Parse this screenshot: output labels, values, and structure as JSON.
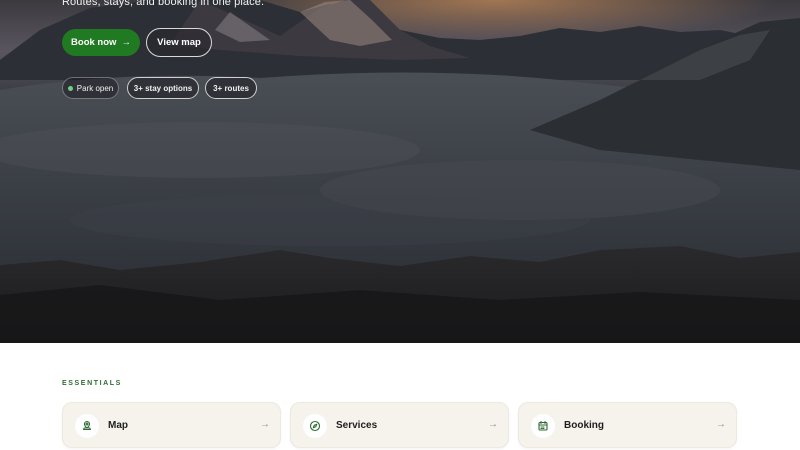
{
  "hero": {
    "tagline": "Routes, stays, and booking in one place.",
    "book_label": "Book now",
    "book_arrow": "→",
    "map_label": "View map",
    "chips": {
      "park": "Park open",
      "stay": "3+ stay options",
      "routes": "3+ routes"
    }
  },
  "essentials": {
    "label": "ESSENTIALS",
    "cards": [
      {
        "label": "Map",
        "icon": "map-pin-icon",
        "arrow": "→"
      },
      {
        "label": "Services",
        "icon": "compass-icon",
        "arrow": "→"
      },
      {
        "label": "Booking",
        "icon": "calendar-icon",
        "arrow": "→"
      }
    ]
  },
  "colors": {
    "accent_green": "#1f7a22",
    "essentials_text": "#2e6b34",
    "card_bg": "#f5f3ec",
    "status_dot": "#6fd08a"
  }
}
